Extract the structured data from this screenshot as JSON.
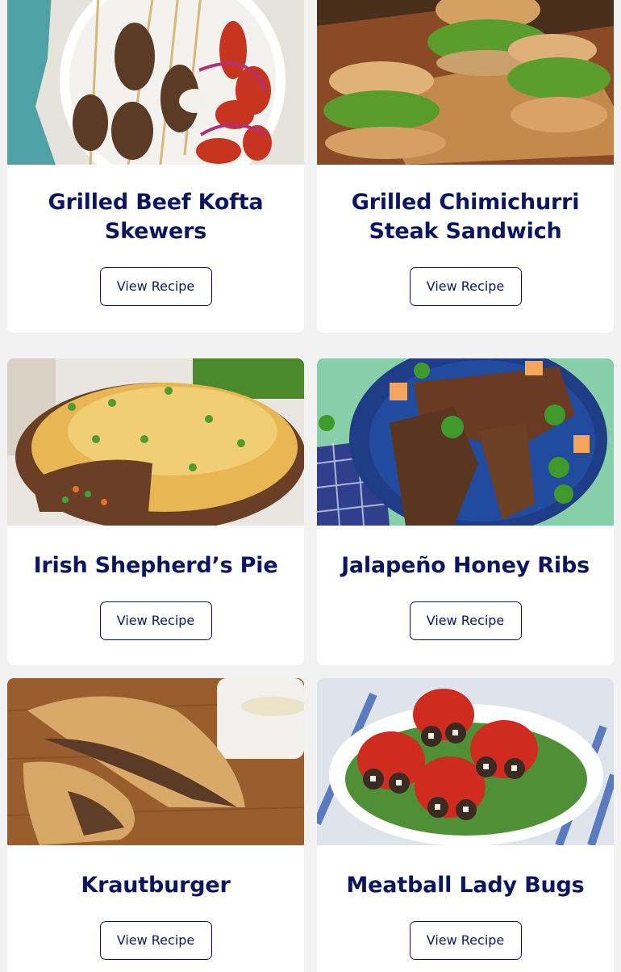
{
  "recipes": [
    {
      "title": "Grilled Beef Kofta Skewers",
      "button": "View Recipe",
      "image_alt": "Grilled beef kofta skewers on a plate with tomatoes and onions"
    },
    {
      "title": "Grilled Chimichurri Steak Sandwich",
      "button": "View Recipe",
      "image_alt": "Steak sandwiches with greens on a cutting board"
    },
    {
      "title": "Irish Shepherd’s Pie",
      "button": "View Recipe",
      "image_alt": "Shepherd's pie in a baking dish"
    },
    {
      "title": "Jalapeño Honey Ribs",
      "button": "View Recipe",
      "image_alt": "Ribs with jalapeño slices on a blue plate"
    },
    {
      "title": "Krautburger",
      "button": "View Recipe",
      "image_alt": "Stuffed bread pockets cut in half"
    },
    {
      "title": "Meatball Lady Bugs",
      "button": "View Recipe",
      "image_alt": "Meatballs decorated as lady bugs with tomatoes and olives"
    }
  ],
  "colors": {
    "title": "#0c1660",
    "background": "#f2f2f3",
    "card": "#ffffff"
  }
}
